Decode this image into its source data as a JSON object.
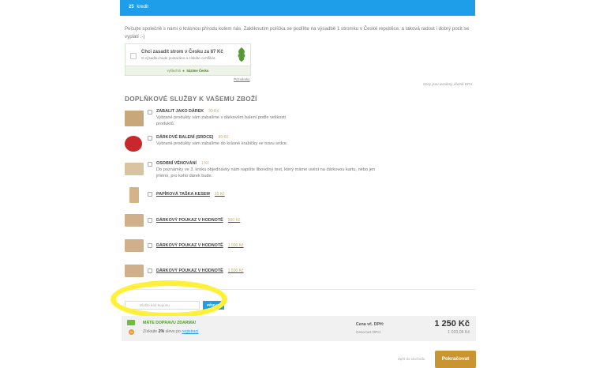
{
  "banner": {
    "credit_value": "25",
    "credit_label": "kredit"
  },
  "intro": {
    "text": "Pečujte společně s námi o krásnou přírodu kolem nás. Zakliknutím políčka se podílíte na výsadbě 1 stromku v České republice, a taková radost i dobrý pocit se vyplatí :-)"
  },
  "tree": {
    "title": "Chci zasadit strom v Česku za 87 Kč",
    "subtitle": "O výsadbu bude postaráno a získáte certifikát.",
    "footer_prefix": "vyšlechtit",
    "footer_brand": "Sázíme Česko",
    "note_link": "Poznámky",
    "leaf_color": "#5a9e3a"
  },
  "vat_note": "Ceny jsou uvedeny včetně DPH",
  "section_title": "DOPLŇKOVÉ SLUŽBY K VAŠEMU ZBOŽÍ",
  "services": [
    {
      "name": "ZABALIT JAKO DÁREK",
      "price": "99 Kč",
      "desc": "Vybrané produkty vám zabalíme v dárkovém balení podle velikosti produktů.",
      "thumb_color": "#c8a878",
      "icon": "gift-box-icon"
    },
    {
      "name": "DÁRKOVÉ BALENÍ (SRDCE)",
      "price": "99 Kč",
      "desc": "Vybrané produkty vám zabalíme do krásné krabičky ve tvaru srdce.",
      "thumb_color": "#c6282b",
      "icon": "heart-box-icon"
    },
    {
      "name": "OSOBNÍ VĚNOVÁNÍ",
      "price": "1 Kč",
      "desc": "Do poznámky ve 3. kroku objednávky nám napište libovolný text, který máme uvést na dárkovou kartu, nebo jen jméno, pro koho dárek bude.",
      "thumb_color": "#d9c3a0",
      "icon": "card-icon"
    },
    {
      "name": "PAPÍROVÁ TAŠKA KESEM",
      "price": "15 Kč",
      "desc": "",
      "thumb_color": "#d4b387",
      "icon": "paper-bag-icon"
    },
    {
      "name": "DÁRKOVÝ POUKAZ V HODNOTĚ",
      "price": "500 Kč",
      "desc": "",
      "thumb_color": "#cfb08a",
      "icon": "voucher-icon"
    },
    {
      "name": "DÁRKOVÝ POUKAZ V HODNOTĚ",
      "price": "1 000 Kč",
      "desc": "",
      "thumb_color": "#cfb08a",
      "icon": "voucher-icon"
    },
    {
      "name": "DÁRKOVÝ POUKAZ V HODNOTĚ",
      "price": "1 500 Kč",
      "desc": "",
      "thumb_color": "#cfb08a",
      "icon": "voucher-icon"
    }
  ],
  "coupon": {
    "placeholder": "Vložte kód kuponu",
    "apply_label": "PŘIDAT"
  },
  "highlight_color": "#fff13a",
  "summary": {
    "free_shipping": "MÁTE DOPRAVU ZDARMA!",
    "discount_prefix": "Získejte",
    "discount_value": "2%",
    "discount_middle": "slevu po",
    "discount_link": "registraci",
    "total_label": "Cena vč. DPH:",
    "net_label": "Cena bez DPH:",
    "total_value": "1 250 Kč",
    "net_value": "1 033,06 Kč"
  },
  "nav": {
    "back_label": "Zpět do obchodu",
    "continue_label": "Pokračovat"
  },
  "colors": {
    "accent_blue": "#1e9ee8",
    "gold": "#c99531",
    "green": "#4da324"
  }
}
